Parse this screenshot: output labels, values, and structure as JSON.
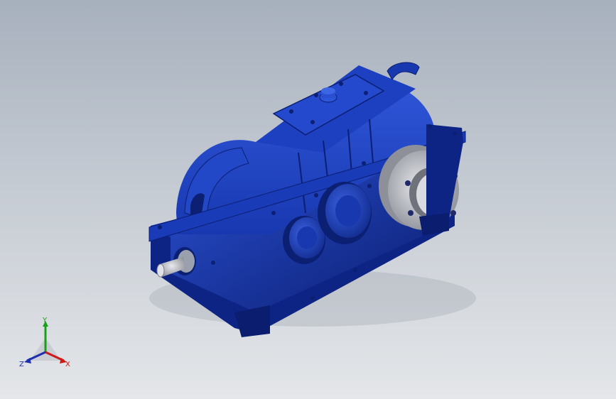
{
  "viewport": {
    "background_top": "#a7b0bd",
    "background_bottom": "#e4e6e9"
  },
  "model": {
    "name_icon": "gearbox-icon",
    "body_color": "#1232a8",
    "body_shade": "#0b1f73",
    "body_light": "#2a4fd0",
    "flange_color": "#b9bcc4",
    "shaft_color": "#c8cad0"
  },
  "triad": {
    "x_label": "X",
    "y_label": "Y",
    "z_label": "Z",
    "x_color": "#d01818",
    "y_color": "#18a018",
    "z_color": "#1e2eb0"
  }
}
